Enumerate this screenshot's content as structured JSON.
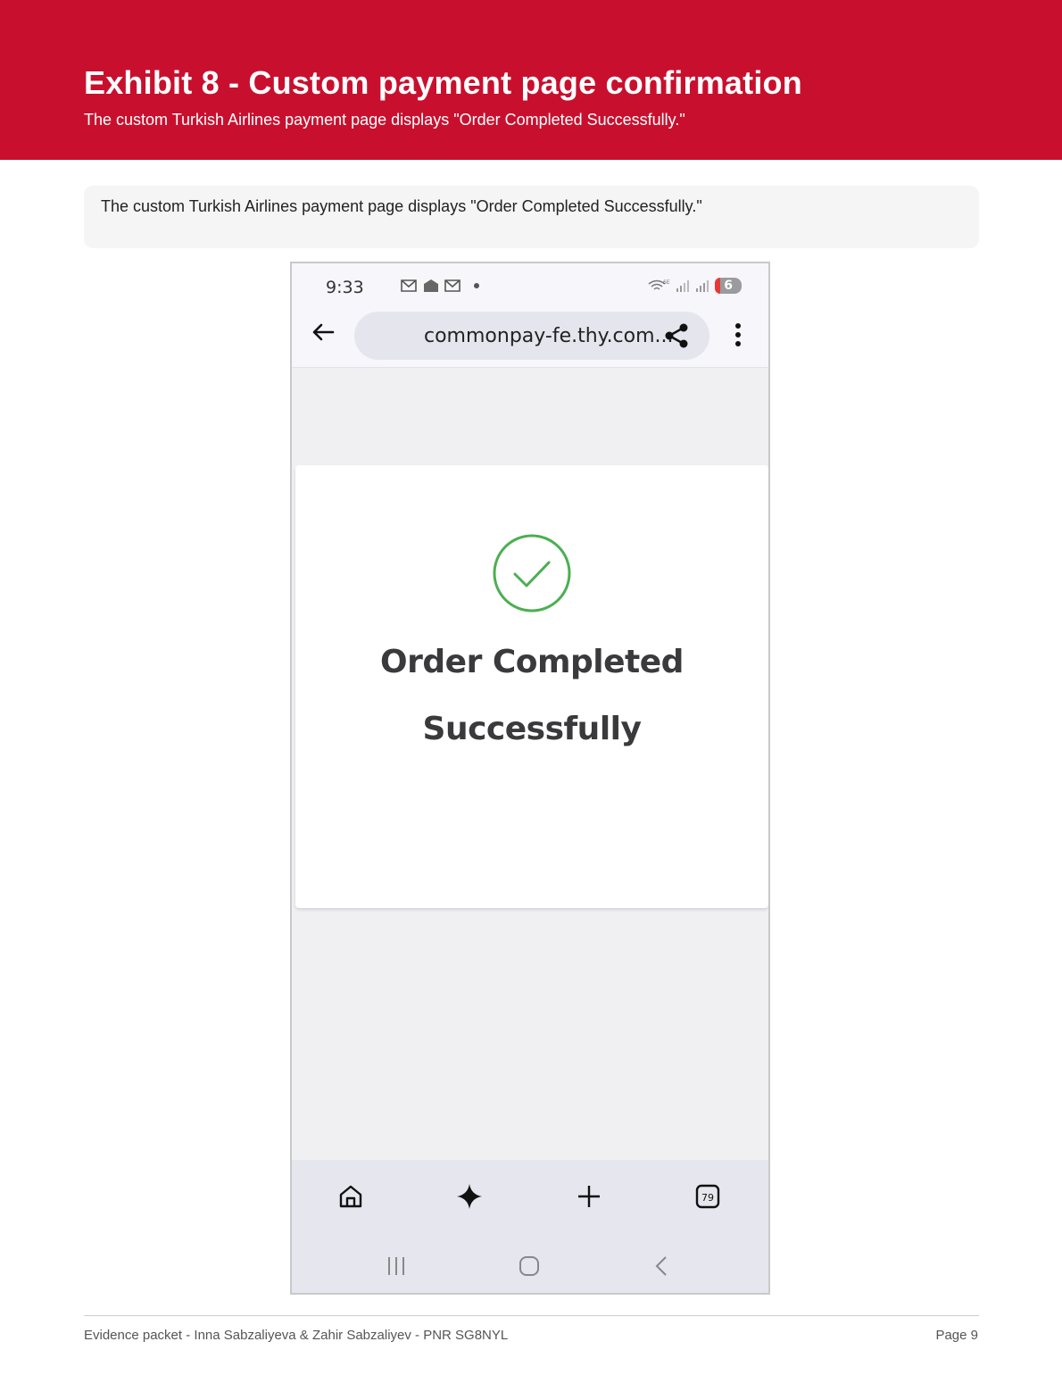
{
  "header": {
    "title": "Exhibit 8 - Custom payment page confirmation",
    "subtitle": "The custom Turkish Airlines payment page displays \"Order Completed Successfully.\""
  },
  "caption": {
    "text": "The custom Turkish Airlines payment page displays \"Order Completed Successfully.\""
  },
  "phone": {
    "status_bar": {
      "time": "9:33",
      "notification_icons": [
        "gmail-icon",
        "inbox-icon",
        "gmail-icon",
        "dot"
      ],
      "wifi_label": "6E",
      "battery": "6"
    },
    "browser": {
      "url": "commonpay-fe.thy.com...",
      "icons": [
        "back-arrow-icon",
        "share-icon",
        "more-vert-icon"
      ]
    },
    "confirmation": {
      "line1": "Order Completed",
      "line2": "Successfully",
      "check_color": "#4caf50"
    },
    "bottom_nav": {
      "items": [
        "home-icon",
        "sparkle-icon",
        "plus-icon",
        "tabs-icon"
      ],
      "tabs_count": "79",
      "system_nav": [
        "recents-icon",
        "home-button-icon",
        "back-icon"
      ]
    }
  },
  "footer": {
    "left": "Evidence packet - Inna Sabzaliyeva & Zahir Sabzaliyev - PNR SG8NYL",
    "right": "Page 9"
  },
  "colors": {
    "brand_red": "#c8102e",
    "success_green": "#4caf50"
  }
}
